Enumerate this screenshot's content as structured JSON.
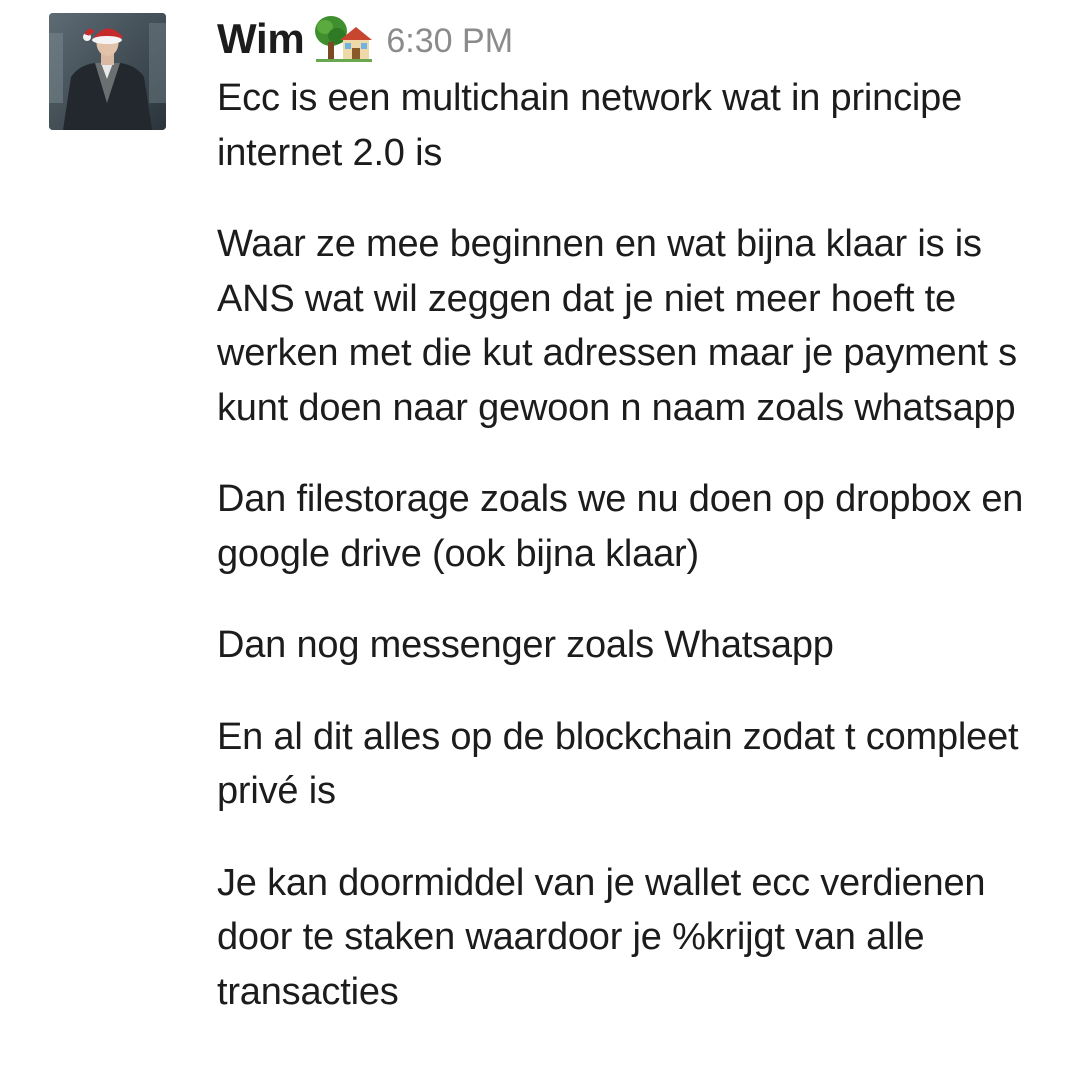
{
  "message": {
    "sender": "Wim",
    "status_emoji": "tree-house-emoji",
    "timestamp": "6:30 PM",
    "avatar": "avatar-photo",
    "paragraphs": [
      "Ecc is een multichain network wat in principe internet 2.0 is",
      "Waar ze mee beginnen en wat bijna klaar is is ANS wat wil zeggen dat je niet meer hoeft te werken met die kut adressen maar je payment s kunt doen naar gewoon n naam zoals whatsapp",
      "Dan filestorage zoals we nu doen op dropbox en google drive (ook bijna klaar)",
      "Dan nog messenger zoals Whatsapp",
      "En al dit alles op de blockchain zodat t compleet privé is",
      "Je kan doormiddel van je wallet ecc verdienen door te staken waardoor je %krijgt van alle transacties"
    ]
  }
}
